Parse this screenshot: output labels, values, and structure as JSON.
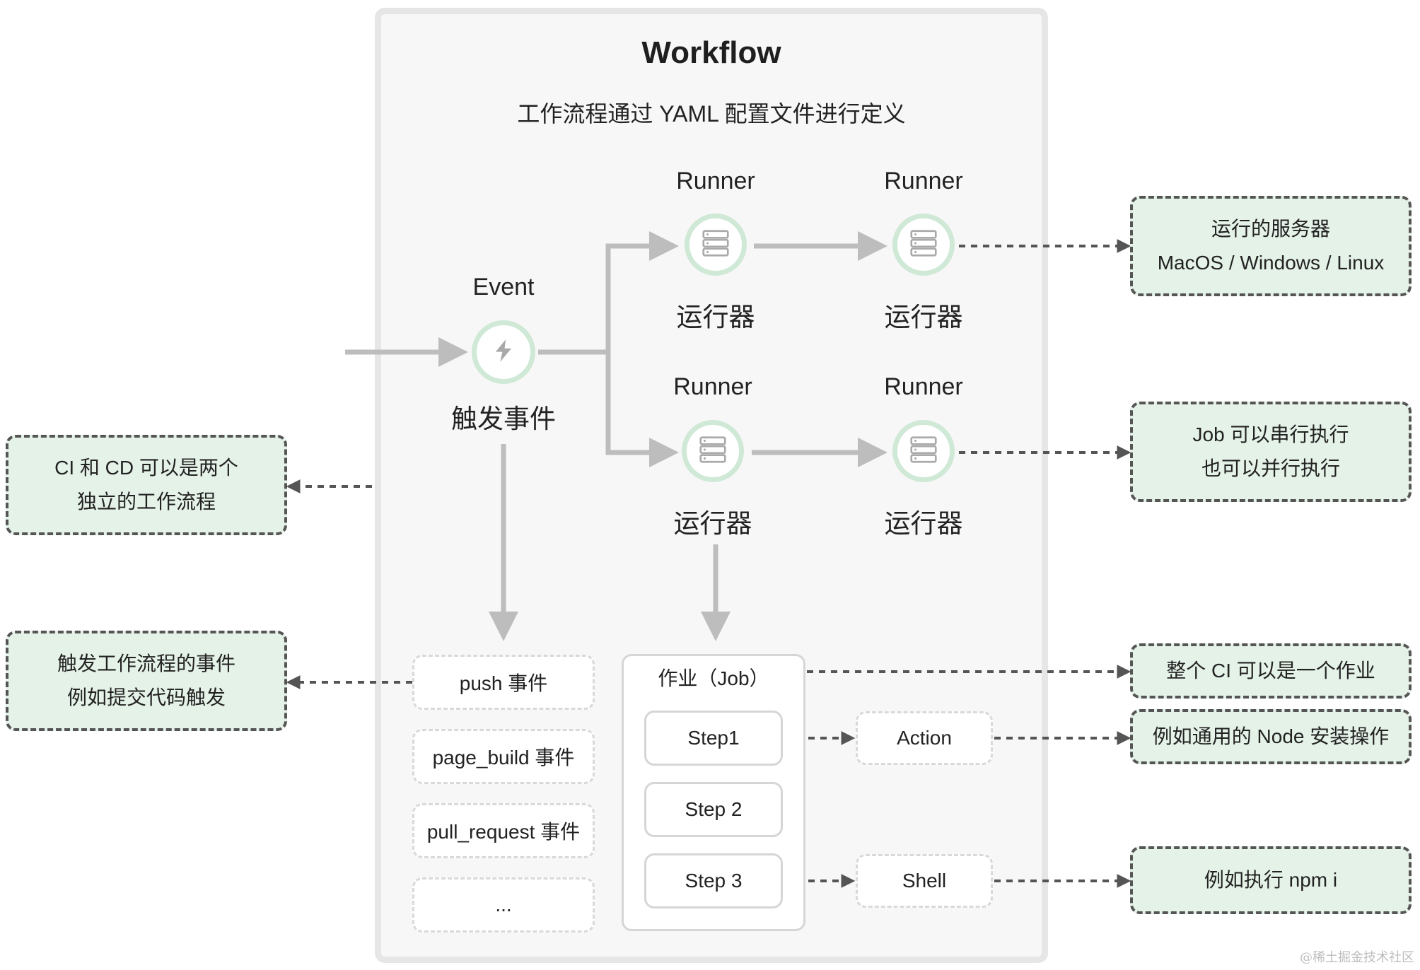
{
  "workflow": {
    "title": "Workflow",
    "subtitle": "工作流程通过 YAML 配置文件进行定义"
  },
  "event_node": {
    "top_label": "Event",
    "bottom_label": "触发事件",
    "icon": "lightning-icon"
  },
  "runners": [
    {
      "top_label": "Runner",
      "bottom_label": "运行器",
      "icon": "server-icon"
    },
    {
      "top_label": "Runner",
      "bottom_label": "运行器",
      "icon": "server-icon"
    },
    {
      "top_label": "Runner",
      "bottom_label": "运行器",
      "icon": "server-icon"
    },
    {
      "top_label": "Runner",
      "bottom_label": "运行器",
      "icon": "server-icon"
    }
  ],
  "events": [
    "push 事件",
    "page_build 事件",
    "pull_request 事件",
    "..."
  ],
  "job": {
    "title": "作业（Job）",
    "steps": [
      "Step1",
      "Step 2",
      "Step 3"
    ]
  },
  "step_targets": {
    "action": "Action",
    "shell": "Shell"
  },
  "notes": {
    "runner_server": {
      "line1": "运行的服务器",
      "line2": "MacOS / Windows / Linux"
    },
    "job_serial": {
      "line1": "Job 可以串行执行",
      "line2": "也可以并行执行"
    },
    "ci_cd": {
      "line1": "CI 和 CD 可以是两个",
      "line2": "独立的工作流程"
    },
    "trigger": {
      "line1": "触发工作流程的事件",
      "line2": "例如提交代码触发"
    },
    "whole_ci": {
      "line1": "整个 CI 可以是一个作业"
    },
    "node_install": {
      "line1": "例如通用的 Node 安装操作"
    },
    "npm": {
      "line1": "例如执行 npm i"
    }
  },
  "watermark": "@稀土掘金技术社区",
  "colors": {
    "note_fill": "#e5f2e8",
    "node_ring": "#cfe9d6",
    "arrow_gray": "#bdbdbd",
    "dashed_dark": "#555555",
    "panel_bg": "#f7f7f7"
  }
}
